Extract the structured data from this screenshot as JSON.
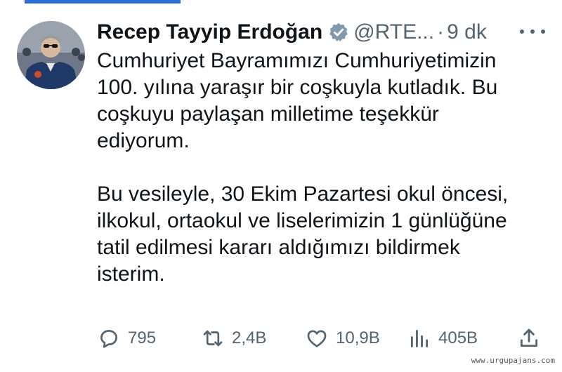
{
  "tweet": {
    "display_name": "Recep Tayyip Erdoğan",
    "handle": "@RTE...",
    "separator": "·",
    "time": "9 dk",
    "paragraphs": [
      "Cumhuriyet Bayramımızı Cumhuriyetimizin\n100. yılına yaraşır bir coşkuyla kutladık. Bu\ncoşkuyu paylaşan milletime teşekkür\nediyorum.",
      "Bu vesileyle, 30 Ekim Pazartesi okul öncesi,\nilkokul, ortaokul ve liselerimizin 1 günlüğüne\ntatil edilmesi kararı aldığımızı bildirmek\nisterim."
    ]
  },
  "actions": {
    "replies": "795",
    "reposts": "2,4B",
    "likes": "10,9B",
    "views": "405B"
  },
  "watermark": "www.urgupajans.com",
  "icons": {
    "verified": "verified-badge-icon",
    "more": "more-icon",
    "reply": "reply-icon",
    "repost": "repost-icon",
    "like": "heart-icon",
    "views": "views-icon",
    "share": "share-icon"
  },
  "colors": {
    "text": "#0f1419",
    "secondary": "#536471",
    "top_bar": "#2a6fd6"
  }
}
